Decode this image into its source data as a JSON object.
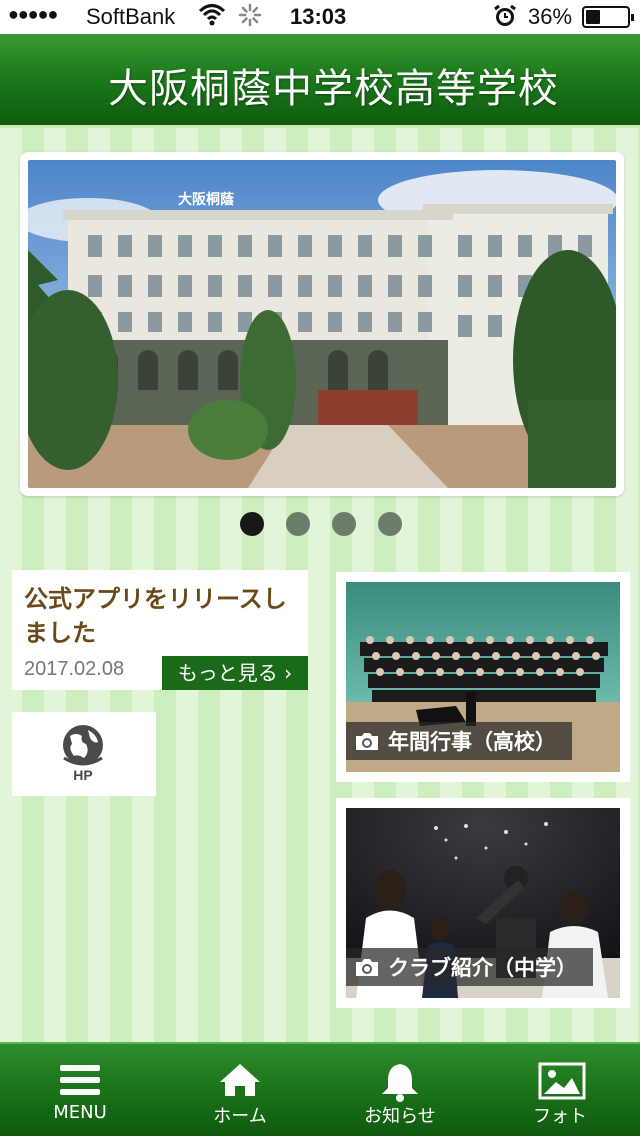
{
  "status_bar": {
    "signal": "●●●●●",
    "carrier": "SoftBank",
    "time": "13:03",
    "battery": "36%",
    "battery_level": 0.36
  },
  "header": {
    "title": "大阪桐蔭中学校高等学校"
  },
  "hero": {
    "building_sign": "大阪桐蔭",
    "pages": 4,
    "active_page": 1
  },
  "news": {
    "title": "公式アプリをリリースしました",
    "date": "2017.02.08",
    "more_label": "もっと見る ›"
  },
  "hp_button": {
    "icon": "globe-hp-icon",
    "label": "HP"
  },
  "photo_tiles": [
    {
      "label": "年間行事（高校）",
      "icon": "camera-icon"
    },
    {
      "label": "クラブ紹介（中学）",
      "icon": "camera-icon"
    }
  ],
  "tabbar": [
    {
      "label": "MENU",
      "icon": "hamburger-icon"
    },
    {
      "label": "ホーム",
      "icon": "home-icon"
    },
    {
      "label": "お知らせ",
      "icon": "bell-icon"
    },
    {
      "label": "フォト",
      "icon": "photo-icon"
    }
  ],
  "colors": {
    "header_green": "#1c7a1b",
    "news_title": "#6b4a1a",
    "more_button": "#1a6a1a",
    "stripe_light": "#e3f5d9",
    "stripe_dark": "#cdeebe"
  }
}
